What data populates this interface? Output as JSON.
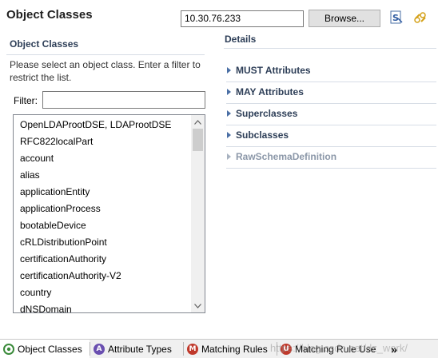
{
  "header": {
    "title": "Object Classes",
    "host_value": "10.30.76.233",
    "browse_label": "Browse..."
  },
  "object_classes_section": {
    "title": "Object Classes",
    "instructions": "Please select an object class. Enter a filter to restrict the list.",
    "filter_label": "Filter:",
    "filter_value": "",
    "items": [
      "OpenLDAProotDSE, LDAProotDSE",
      "RFC822localPart",
      "account",
      "alias",
      "applicationEntity",
      "applicationProcess",
      "bootableDevice",
      "cRLDistributionPoint",
      "certificationAuthority",
      "certificationAuthority-V2",
      "country",
      "dNSDomain"
    ]
  },
  "details_section": {
    "title": "Details",
    "sections": [
      {
        "label": "MUST Attributes",
        "enabled": true
      },
      {
        "label": "MAY Attributes",
        "enabled": true
      },
      {
        "label": "Superclasses",
        "enabled": true
      },
      {
        "label": "Subclasses",
        "enabled": true
      },
      {
        "label": "RawSchemaDefinition",
        "enabled": false
      }
    ]
  },
  "tabs": [
    {
      "label": "Object Classes",
      "icon": "object-class-icon",
      "icon_letter": "O",
      "icon_color": "#3a8a3a",
      "active": true
    },
    {
      "label": "Attribute Types",
      "icon": "attribute-type-icon",
      "icon_letter": "A",
      "icon_color": "#6a4fb0",
      "active": false
    },
    {
      "label": "Matching Rules",
      "icon": "matching-rule-icon",
      "icon_letter": "M",
      "icon_color": "#c0392b",
      "active": false
    },
    {
      "label": "Matching Rule Use",
      "icon": "matching-rule-use-icon",
      "icon_letter": "U",
      "icon_color": "#c0392b",
      "active": false
    }
  ],
  "tab_overflow_label": "»",
  "watermark": "https://blog.csdn.net/dz_work/",
  "colors": {
    "section_title": "#2d3e57",
    "disabled_text": "#8b97a8",
    "separator": "#d7dde6"
  }
}
